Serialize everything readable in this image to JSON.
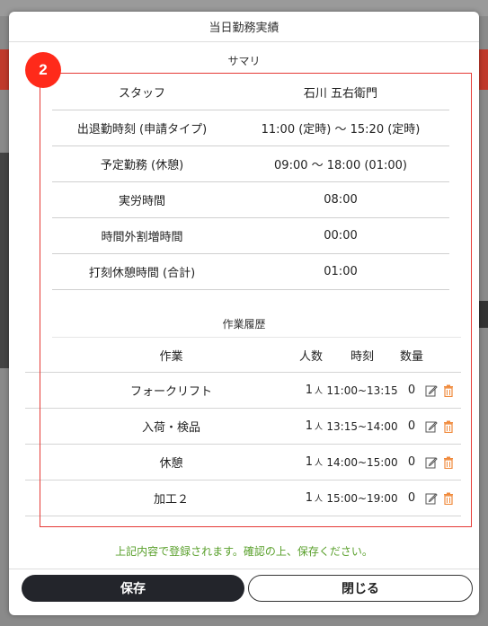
{
  "header": {
    "title": "当日勤務実績"
  },
  "badge": {
    "number": "2"
  },
  "summary": {
    "title": "サマリ",
    "rows": [
      {
        "label": "スタッフ",
        "value": "石川 五右衛門"
      },
      {
        "label": "出退勤時刻 (申請タイプ)",
        "value": "11:00 (定時) 〜 15:20 (定時)"
      },
      {
        "label": "予定勤務 (休憩)",
        "value": "09:00 〜 18:00 (01:00)"
      },
      {
        "label": "実労時間",
        "value": "08:00"
      },
      {
        "label": "時間外割増時間",
        "value": "00:00"
      },
      {
        "label": "打刻休憩時間 (合計)",
        "value": "01:00"
      }
    ]
  },
  "history": {
    "title": "作業履歴",
    "columns": {
      "task": "作業",
      "people": "人数",
      "time": "時刻",
      "qty": "数量"
    },
    "rows": [
      {
        "task": "フォークリフト",
        "people": "1",
        "unit": "人",
        "time": "11:00~13:15",
        "qty": "0"
      },
      {
        "task": "入荷・検品",
        "people": "1",
        "unit": "人",
        "time": "13:15~14:00",
        "qty": "0"
      },
      {
        "task": "休憩",
        "people": "1",
        "unit": "人",
        "time": "14:00~15:00",
        "qty": "0"
      },
      {
        "task": "加工２",
        "people": "1",
        "unit": "人",
        "time": "15:00~19:00",
        "qty": "0"
      }
    ]
  },
  "notice": "上記内容で登録されます。確認の上、保存ください。",
  "buttons": {
    "save": "保存",
    "close": "閉じる"
  },
  "colors": {
    "accent_red": "#e53935",
    "badge_red": "#ff2a1a",
    "notice_green": "#5aa02c",
    "save_bg": "#23252b",
    "trash_orange": "#f08a3c"
  }
}
